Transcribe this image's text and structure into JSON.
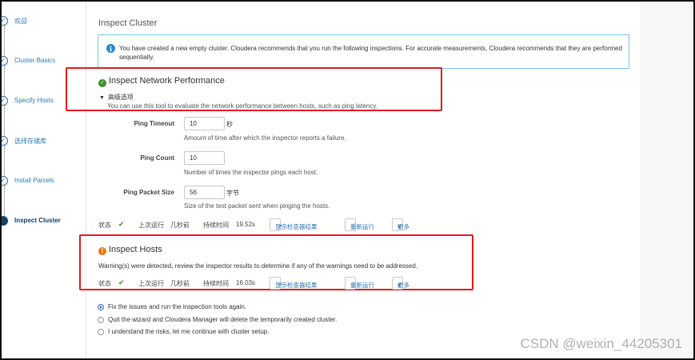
{
  "sidebar": {
    "steps": [
      {
        "label": "欢迎",
        "active": false
      },
      {
        "label": "Cluster Basics",
        "active": false
      },
      {
        "label": "Specify Hosts",
        "active": false
      },
      {
        "label": "选择存储库",
        "active": false
      },
      {
        "label": "Install Parcels",
        "active": false
      },
      {
        "label": "Inspect Cluster",
        "active": true
      }
    ]
  },
  "main": {
    "title": "Inspect Cluster",
    "info_text": "You have created a new empty cluster. Cloudera recommends that you run the following inspections. For accurate measurements, Cloudera recommends that they are performed sequentially.",
    "network": {
      "title": "Inspect Network Performance",
      "advanced_label": "高级选项",
      "description": "You can use this tool to evaluate the network performance between hosts, such as ping latency.",
      "fields": [
        {
          "label": "Ping Timeout",
          "value": "10",
          "unit": "秒",
          "help": "Amount of time after which the inspector reports a failure."
        },
        {
          "label": "Ping Count",
          "value": "10",
          "unit": "",
          "help": "Number of times the inspector pings each host."
        },
        {
          "label": "Ping Packet Size",
          "value": "56",
          "unit": "字节",
          "help": "Size of the test packet sent when pinging the hosts."
        }
      ],
      "status": {
        "status_label": "状态",
        "last_run_label": "上次运行",
        "last_run_value": "几秒前",
        "duration_label": "持续时间",
        "duration_value": "19.52s",
        "show_results_button": "显示检查器结果",
        "rerun_button": "重新运行",
        "more_button": "更多"
      }
    },
    "hosts": {
      "title": "Inspect Hosts",
      "warning": "Warning(s) were detected, review the inspector results to determine if any of the warnings need to be addressed.",
      "status": {
        "status_label": "状态",
        "last_run_label": "上次运行",
        "last_run_value": "几秒前",
        "duration_label": "持续时间",
        "duration_value": "16.03s",
        "show_results_button": "显示检查器结果",
        "rerun_button": "重新运行",
        "more_button": "更多"
      }
    },
    "options": [
      {
        "label": "Fix the issues and run the inspection tools again.",
        "checked": true
      },
      {
        "label": "Quit the wizard and Cloudera Manager will delete the temporarily created cluster.",
        "checked": false
      },
      {
        "label": "I understand the risks, let me continue with cluster setup.",
        "checked": false
      }
    ]
  },
  "watermark": "CSDN @weixin_44205301",
  "colors": {
    "accent": "#2b73b5",
    "success": "#3a8f2c",
    "warning": "#e8781a",
    "highlight": "#e51b1b",
    "info_border": "#78c6e6"
  }
}
